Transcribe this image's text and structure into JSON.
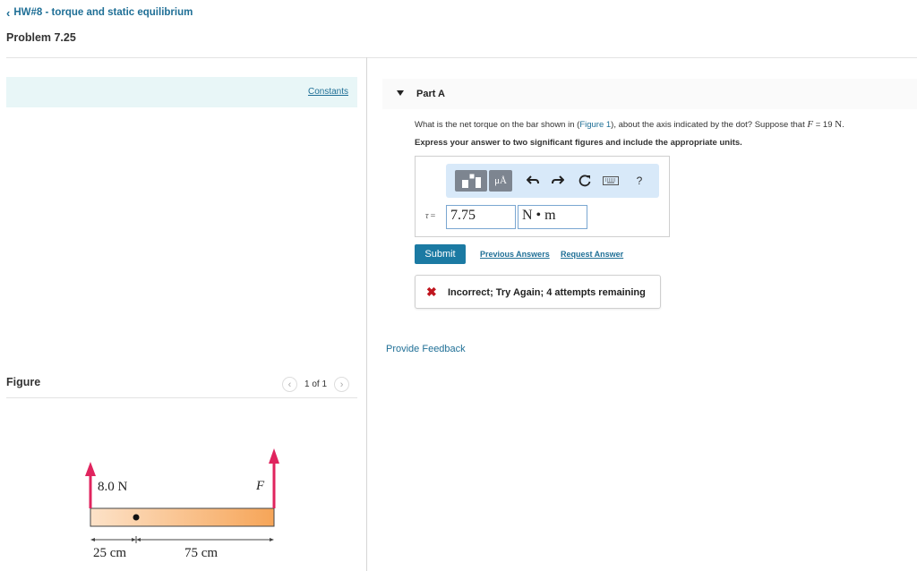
{
  "breadcrumb": {
    "label": "HW#8 - torque and static equilibrium"
  },
  "problem": {
    "title": "Problem 7.25"
  },
  "constants": {
    "label": "Constants"
  },
  "figure": {
    "label": "Figure",
    "pager": {
      "text": "1 of 1"
    },
    "force_left": "8.0 N",
    "force_right": "F",
    "dist_left": "25 cm",
    "dist_right": "75 cm"
  },
  "part": {
    "label": "Part A",
    "question_text": "What is the net torque on the bar shown in (",
    "figure_link": "Figure 1",
    "question_text2": "), about the axis indicated by the dot? Suppose that ",
    "var": "F",
    "eq": " = 19 ",
    "unit": "N",
    "end": ".",
    "instruction": "Express your answer to two significant figures and include the appropriate units."
  },
  "answer": {
    "symbol": "τ",
    "eq": "=",
    "value": "7.75",
    "unit": "N • m",
    "toolbar": {
      "units_label": "μÅ",
      "help_label": "?"
    }
  },
  "actions": {
    "submit_label": "Submit",
    "previous_answers_label": "Previous Answers",
    "request_answer_label": "Request Answer"
  },
  "feedback": {
    "text": "Incorrect; Try Again; 4 attempts remaining"
  },
  "provide_feedback": {
    "label": "Provide Feedback"
  },
  "colors": {
    "accent": "#1b7aa3",
    "error": "#c0161f",
    "arrow": "#e0245e",
    "bar": "#f7b77a"
  },
  "icons": [
    "chevron-left-icon",
    "templates-icon",
    "undo-icon",
    "redo-icon",
    "reset-icon",
    "keyboard-icon",
    "help-icon",
    "error-x-icon"
  ]
}
